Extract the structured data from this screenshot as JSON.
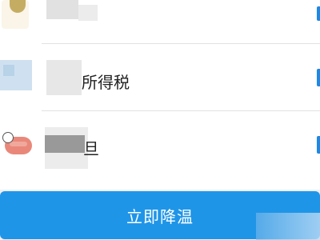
{
  "list": {
    "items": [
      {
        "label": "",
        "icon": "gold-coin-app-icon"
      },
      {
        "label": "所得税",
        "icon": "blue-app-icon"
      },
      {
        "label": "旦",
        "icon": "red-badge-app-icon"
      }
    ]
  },
  "footer": {
    "cool_down_label": "立即降温"
  },
  "colors": {
    "accent": "#1f95e8",
    "divider": "#e2e2e2",
    "background": "#ffffff"
  }
}
